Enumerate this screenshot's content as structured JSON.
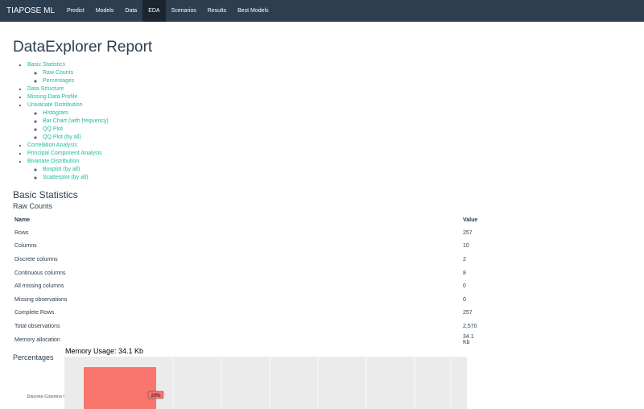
{
  "nav": {
    "brand": "TIAPOSE ML",
    "items": [
      "Predict",
      "Models",
      "Data",
      "EDA",
      "Scenarios",
      "Results",
      "Best Models"
    ],
    "active_index": 3
  },
  "report": {
    "title": "DataExplorer Report",
    "toc": [
      {
        "label": "Basic Statistics",
        "children": [
          "Raw Counts",
          "Percentages"
        ]
      },
      {
        "label": "Data Structure",
        "children": []
      },
      {
        "label": "Missing Data Profile",
        "children": []
      },
      {
        "label": "Univariate Distribution",
        "children": [
          "Histogram",
          "Bar Chart (with frequency)",
          "QQ Plot",
          "QQ Plot (by all)"
        ]
      },
      {
        "label": "Correlation Analysis",
        "children": []
      },
      {
        "label": "Principal Component Analysis",
        "children": []
      },
      {
        "label": "Bivariate Distribution",
        "children": [
          "Boxplot (by all)",
          "Scatterplot (by all)"
        ]
      }
    ]
  },
  "basic_statistics": {
    "heading": "Basic Statistics",
    "raw_counts_heading": "Raw Counts",
    "columns": [
      "Name",
      "Value"
    ],
    "rows": [
      [
        "Rows",
        "257"
      ],
      [
        "Columns",
        "10"
      ],
      [
        "Discrete columns",
        "2"
      ],
      [
        "Continuous columns",
        "8"
      ],
      [
        "All missing columns",
        "0"
      ],
      [
        "Missing observations",
        "0"
      ],
      [
        "Complete Rows",
        "257"
      ],
      [
        "Total observations",
        "2,570"
      ],
      [
        "Memory allocation",
        "34.1 Kb"
      ]
    ],
    "percentages_heading": "Percentages"
  },
  "chart_data": {
    "type": "bar",
    "title": "Memory Usage: 34.1 Kb",
    "categories": [
      "Discrete Columns"
    ],
    "values": [
      20
    ],
    "labels": [
      "20%"
    ],
    "bar_color": "#f8766d",
    "panel_color": "#ebebeb",
    "grid": true
  }
}
